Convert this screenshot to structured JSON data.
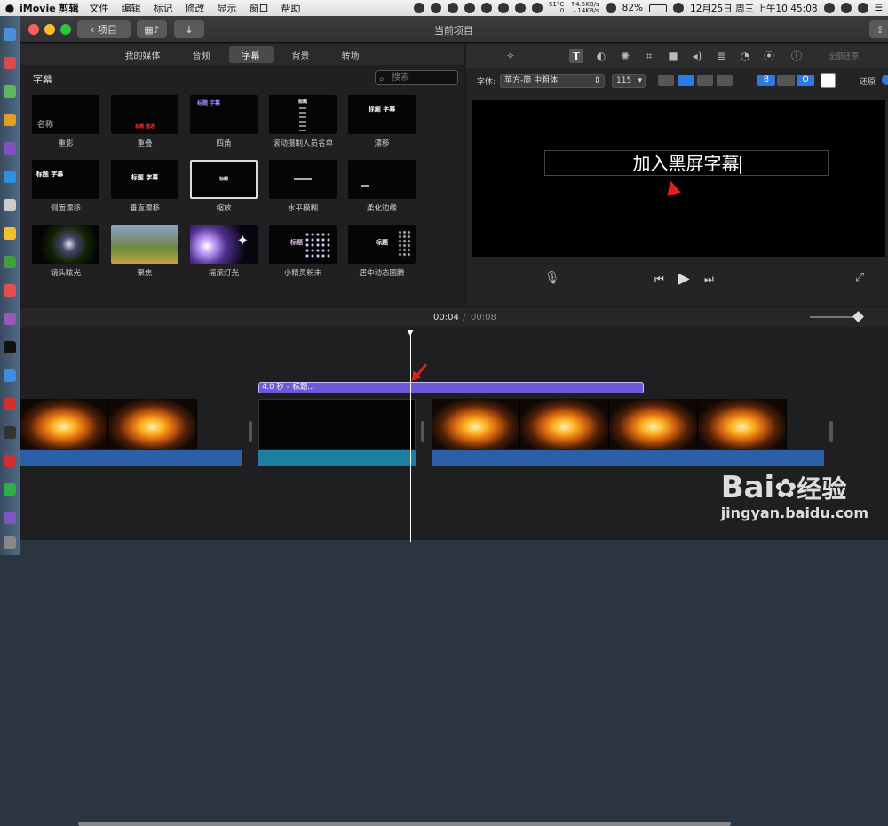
{
  "menubar": {
    "app": "iMovie 剪辑",
    "items": [
      "文件",
      "编辑",
      "标记",
      "修改",
      "显示",
      "窗口",
      "帮助"
    ],
    "temp": "51°C",
    "cpu": "0",
    "up": "↑4.5KB/s",
    "down": "↓14KB/s",
    "datetime": "12月25日 周三 上午10:45:08",
    "battery": "82%"
  },
  "window": {
    "back_label": "项目",
    "title": "当前项目"
  },
  "browser": {
    "tabs": [
      "我的媒体",
      "音频",
      "字幕",
      "背景",
      "转场"
    ],
    "active_tab": "字幕",
    "category": "字幕",
    "search_placeholder": "搜索",
    "titles": [
      "重影",
      "重叠",
      "四角",
      "滚动摄制人员名单",
      "漂移",
      "侧面漂移",
      "垂直漂移",
      "缩放",
      "水平模糊",
      "柔化边缘",
      "镜头眩光",
      "聚焦",
      "摇滚灯光",
      "小精灵粉末",
      "居中动态图腾"
    ],
    "thumb_texts": {
      "ghost": "名称",
      "overlap": "标题 描述",
      "corner": "标题 字幕",
      "scroll": "标题",
      "drift": "标题 字幕",
      "side": "标题 字幕",
      "vert": "标题 字幕",
      "zoom": "标题",
      "sparkle": "标题",
      "center": "标题"
    }
  },
  "viewer": {
    "reset_all": "全部还原",
    "font_label": "字体:",
    "font_value": "苹方-简 中粗体",
    "font_size": "115",
    "bold": "B",
    "outline": "O",
    "revert": "还原",
    "canvas_text": "加入黑屏字幕"
  },
  "timeline": {
    "current": "00:04",
    "separator": "/",
    "total": "00:08",
    "clip_label": "4.0 秒 – 标题..."
  },
  "watermark": {
    "brand": "Bai",
    "brand2": "经验",
    "url": "jingyan.baidu.com"
  }
}
